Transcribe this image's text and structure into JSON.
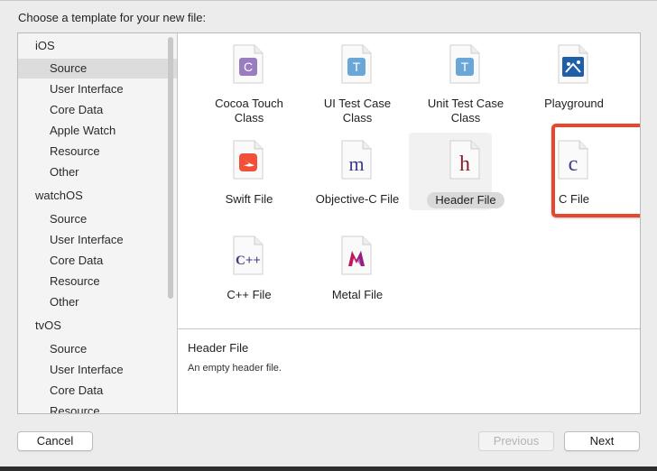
{
  "dialog": {
    "prompt": "Choose a template for your new file:"
  },
  "sidebar": {
    "groups": [
      {
        "label": "iOS",
        "items": [
          "Source",
          "User Interface",
          "Core Data",
          "Apple Watch",
          "Resource",
          "Other"
        ],
        "selected": "Source"
      },
      {
        "label": "watchOS",
        "items": [
          "Source",
          "User Interface",
          "Core Data",
          "Resource",
          "Other"
        ]
      },
      {
        "label": "tvOS",
        "items": [
          "Source",
          "User Interface",
          "Core Data",
          "Resource"
        ]
      }
    ]
  },
  "templates": [
    {
      "name": "Cocoa Touch Class",
      "icon": "cocoa-touch-class-icon",
      "glyph": "C",
      "line1": "Cocoa Touch",
      "line2": "Class"
    },
    {
      "name": "UI Test Case Class",
      "icon": "ui-test-case-class-icon",
      "glyph": "T",
      "line1": "UI Test Case",
      "line2": "Class"
    },
    {
      "name": "Unit Test Case Class",
      "icon": "unit-test-case-class-icon",
      "glyph": "T",
      "line1": "Unit Test Case",
      "line2": "Class"
    },
    {
      "name": "Playground",
      "icon": "playground-icon",
      "glyph": "",
      "line1": "Playground",
      "line2": ""
    },
    {
      "name": "Swift File",
      "icon": "swift-file-icon",
      "glyph": "",
      "line1": "Swift File",
      "line2": ""
    },
    {
      "name": "Objective-C File",
      "icon": "objective-c-file-icon",
      "glyph": "m",
      "line1": "Objective-C File",
      "line2": ""
    },
    {
      "name": "Header File",
      "icon": "header-file-icon",
      "glyph": "h",
      "line1": "Header File",
      "line2": "",
      "selected": true
    },
    {
      "name": "C File",
      "icon": "c-file-icon",
      "glyph": "c",
      "line1": "C File",
      "line2": ""
    },
    {
      "name": "C++ File",
      "icon": "cpp-file-icon",
      "glyph": "C++",
      "line1": "C++ File",
      "line2": ""
    },
    {
      "name": "Metal File",
      "icon": "metal-file-icon",
      "glyph": "M",
      "line1": "Metal File",
      "line2": ""
    }
  ],
  "description": {
    "title": "Header File",
    "text": "An empty header file."
  },
  "buttons": {
    "cancel": "Cancel",
    "previous": "Previous",
    "next": "Next"
  },
  "colors": {
    "highlight": "#e8472f",
    "cocoa": "#8e6fb4",
    "test": "#5b9bd5",
    "playground": "#1f5fa8",
    "swift": "#f05138",
    "objc_header": "#8a1c2b",
    "c_files": "#3d3d8c",
    "metal": "#c2185b"
  }
}
